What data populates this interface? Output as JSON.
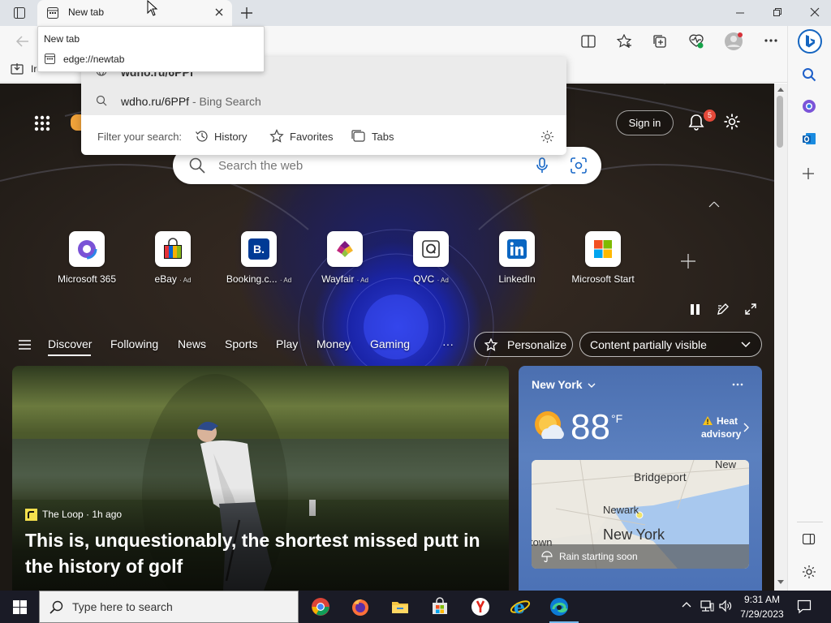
{
  "browser": {
    "tab_title": "New tab",
    "tooltip_title": "New tab",
    "tooltip_url": "edge://newtab",
    "favbar_partial": "Ir"
  },
  "omnibox": {
    "suggestion_1": "wdho.ru/6PPf",
    "suggestion_2_query": "wdho.ru/6PPf",
    "suggestion_2_suffix": " - Bing Search",
    "filter_label": "Filter your search:",
    "filter_history": "History",
    "filter_favorites": "Favorites",
    "filter_tabs": "Tabs"
  },
  "newtab": {
    "search_placeholder": "Search the web",
    "sign_in": "Sign in",
    "notification_count": "5",
    "quick_links": [
      {
        "label": "Microsoft 365",
        "ad": ""
      },
      {
        "label": "eBay",
        "ad": "· Ad"
      },
      {
        "label": "Booking.c...",
        "ad": "· Ad"
      },
      {
        "label": "Wayfair",
        "ad": "· Ad"
      },
      {
        "label": "QVC",
        "ad": "· Ad"
      },
      {
        "label": "LinkedIn",
        "ad": ""
      },
      {
        "label": "Microsoft Start",
        "ad": ""
      }
    ],
    "nav": {
      "discover": "Discover",
      "following": "Following",
      "news": "News",
      "sports": "Sports",
      "play": "Play",
      "money": "Money",
      "gaming": "Gaming",
      "more": "···",
      "personalize": "Personalize",
      "content_visibility": "Content partially visible"
    },
    "news_card": {
      "source": "The Loop · 1h ago",
      "headline": "This is, unquestionably, the shortest missed putt in the history of golf"
    },
    "weather": {
      "city": "New York",
      "temperature": "88",
      "unit": "°F",
      "alert_line1": "Heat",
      "alert_line2": "advisory",
      "map_bridgeport": "Bridgeport",
      "map_new": "New",
      "map_newark": "Newark",
      "map_newyork": "New York",
      "map_town": "town",
      "rain": "Rain starting soon"
    }
  },
  "taskbar": {
    "search_placeholder": "Type here to search",
    "time": "9:31 AM",
    "date": "7/29/2023"
  },
  "colors": {
    "accent": "#0f6cbd",
    "taskbar": "#1a1b26",
    "weather_bg": "#5b80bf",
    "badge": "#e5493a"
  }
}
